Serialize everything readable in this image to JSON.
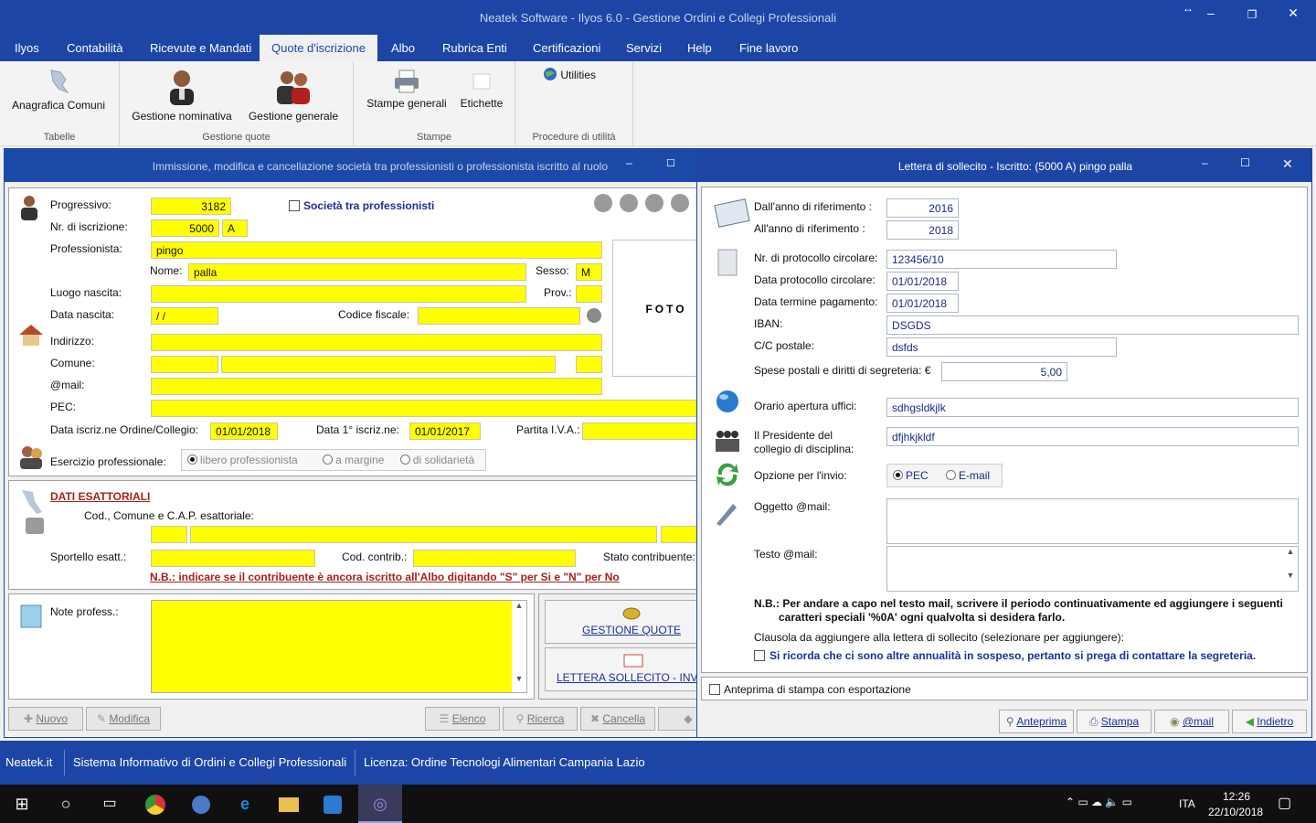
{
  "app": {
    "title": "Neatek Software - Ilyos 6.0 - Gestione Ordini e Collegi Professionali"
  },
  "menu": [
    "Ilyos",
    "Contabilità",
    "Ricevute e Mandati",
    "Quote d'iscrizione",
    "Albo",
    "Rubrica Enti",
    "Certificazioni",
    "Servizi",
    "Help",
    "Fine lavoro"
  ],
  "ribbon": {
    "anagrafica": "Anagrafica Comuni",
    "tabelle": "Tabelle",
    "gest_nom": "Gestione nominativa",
    "gest_gen": "Gestione generale",
    "gest_quote": "Gestione quote",
    "stampe_gen": "Stampe generali",
    "etichette": "Etichette",
    "stampe": "Stampe",
    "utilities": "Utilities",
    "procedure": "Procedure di utilità"
  },
  "left": {
    "title": "Immissione, modifica e cancellazione società tra professionisti o professionista iscritto al ruolo",
    "progressivo_lbl": "Progressivo:",
    "progressivo": "3182",
    "societa_lbl": "Società tra professionisti",
    "nr_lbl": "Nr. di iscrizione:",
    "nr": "5000",
    "nr_suffix": "A",
    "prof_lbl": "Professionista:",
    "prof": "pingo",
    "nome_lbl": "Nome:",
    "nome": "palla",
    "sesso_lbl": "Sesso:",
    "sesso": "M",
    "luogo_lbl": "Luogo nascita:",
    "prov_lbl": "Prov.:",
    "data_lbl": "Data nascita:",
    "data": " / /",
    "cf_lbl": "Codice fiscale:",
    "foto": "FOTO",
    "indirizzo_lbl": "Indirizzo:",
    "comune_lbl": "Comune:",
    "mail_lbl": "@mail:",
    "pec_lbl": "PEC:",
    "iscr_lbl": "Data iscriz.ne Ordine/Collegio:",
    "iscr": "01/01/2018",
    "iscr1_lbl": "Data 1° iscriz.ne:",
    "iscr1": "01/01/2017",
    "piva_lbl": "Partita I.V.A.:",
    "esercizio_lbl": "Esercizio professionale:",
    "opt1": "libero professionista",
    "opt2": "a margine",
    "opt3": "di solidarietà",
    "dati_esatt": "DATI ESATTORIALI",
    "cod_lbl": "Cod., Comune e C.A.P. esattoriale:",
    "sportello_lbl": "Sportello esatt.:",
    "codcontrib_lbl": "Cod. contrib.:",
    "stato_lbl": "Stato contribuente:",
    "nb": "N.B.: indicare se il contribuente è ancora iscritto all'Albo digitando \"S\" per Si e \"N\" per No",
    "note_lbl": "Note profess.:",
    "gest_quote_btn": "GESTIONE QUOTE",
    "lettera_btn": "LETTERA SOLLECITO - INVIO P",
    "buttons": {
      "nuovo": "Nuovo",
      "modifica": "Modifica",
      "elenco": "Elenco",
      "ricerca": "Ricerca",
      "cancella": "Cancella"
    }
  },
  "right": {
    "title": "Lettera di sollecito - Iscritto: (5000 A) pingo palla",
    "dal_lbl": "Dall'anno di riferimento :",
    "dal": "2016",
    "al_lbl": "All'anno  di riferimento  :",
    "al": "2018",
    "prot_lbl": "Nr. di protocollo circolare:",
    "prot": "123456/10",
    "dataprot_lbl": "Data protocollo circolare:",
    "dataprot": "01/01/2018",
    "term_lbl": "Data termine pagamento:",
    "term": "01/01/2018",
    "iban_lbl": "IBAN:",
    "iban": "DSGDS",
    "cc_lbl": "C/C postale:",
    "cc": "dsfds",
    "spese_lbl": "Spese postali e diritti di segreteria: €",
    "spese": "5,00",
    "orario_lbl": "Orario apertura uffici:",
    "orario": "sdhgsldkjlk",
    "pres_lbl1": "Il Presidente del",
    "pres_lbl2": "collegio di disciplina:",
    "pres": "dfjhkjkldf",
    "opz_lbl": "Opzione per l'invio:",
    "pec": "PEC",
    "email": "E-mail",
    "oggetto_lbl": "Oggetto @mail:",
    "testo_lbl": "Testo @mail:",
    "nb1": "N.B.: Per andare  a capo nel testo mail,  scrivere  il periodo continuativamente ed aggiungere i seguenti",
    "nb2": "caratteri speciali   '%0A'  ogni qualvolta si desidera farlo.",
    "clausola": "Clausola da aggiungere alla lettera di  sollecito (selezionare per aggiungere):",
    "clausola_chk": "Si ricorda che ci sono altre annualità in sospeso, pertanto si prega di contattare la segreteria.",
    "anteprima_chk": "Anteprima di stampa con esportazione",
    "btn_anteprima": "Anteprima",
    "btn_stampa": "Stampa",
    "btn_mail": "@mail",
    "btn_indietro": "Indietro"
  },
  "status": {
    "a": "Neatek.it",
    "b": "Sistema Informativo di Ordini e Collegi Professionali",
    "c": "Licenza: Ordine Tecnologi Alimentari Campania Lazio"
  },
  "taskbar": {
    "lang": "ITA",
    "time": "12:26",
    "date": "22/10/2018"
  }
}
